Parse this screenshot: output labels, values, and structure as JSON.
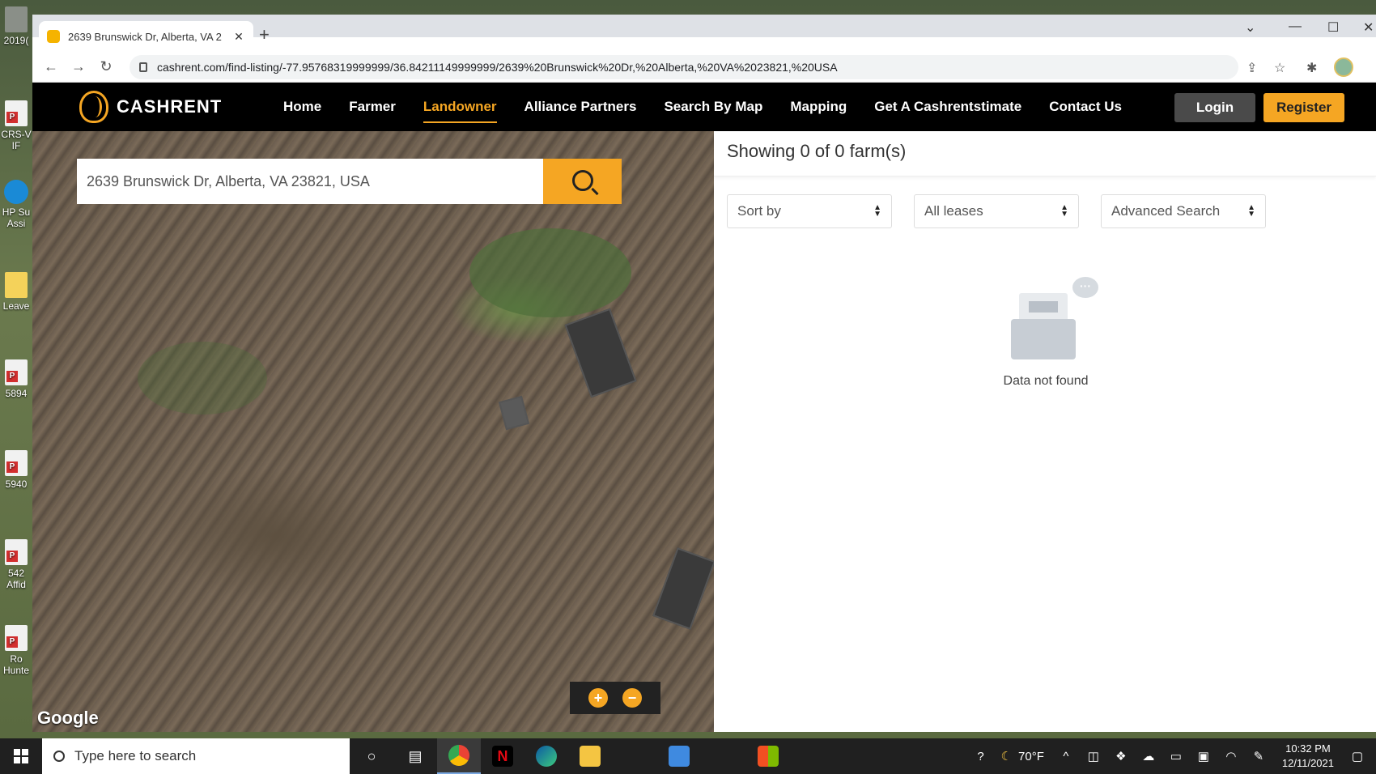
{
  "desktop": {
    "icons": [
      {
        "label": "2019(",
        "type": "photo"
      },
      {
        "label": "CRS-V IF",
        "type": "pdf"
      },
      {
        "label": "HP Su Assi",
        "type": "hp"
      },
      {
        "label": "Leave",
        "type": "folder"
      },
      {
        "label": "5894",
        "type": "pdf"
      },
      {
        "label": "5940",
        "type": "pdf"
      },
      {
        "label": "542 Affid",
        "type": "pdf"
      },
      {
        "label": "Ro Hunte",
        "type": "pdf"
      }
    ]
  },
  "browser": {
    "tab_title": "2639 Brunswick Dr, Alberta, VA 2",
    "url": "cashrent.com/find-listing/-77.95768319999999/36.84211149999999/2639%20Brunswick%20Dr,%20Alberta,%20VA%2023821,%20USA"
  },
  "site": {
    "logo_text": "CASHRENT",
    "nav": [
      {
        "label": "Home",
        "active": false
      },
      {
        "label": "Farmer",
        "active": false
      },
      {
        "label": "Landowner",
        "active": true
      },
      {
        "label": "Alliance Partners",
        "active": false
      },
      {
        "label": "Search By Map",
        "active": false
      },
      {
        "label": "Mapping",
        "active": false
      },
      {
        "label": "Get A Cashrentstimate",
        "active": false
      },
      {
        "label": "Contact Us",
        "active": false
      }
    ],
    "login_label": "Login",
    "register_label": "Register",
    "accent_color": "#f5a623"
  },
  "map": {
    "search_value": "2639 Brunswick Dr, Alberta, VA 23821, USA",
    "zoom_in": "+",
    "zoom_out": "−",
    "attribution": "Google"
  },
  "results": {
    "heading": "Showing 0 of 0 farm(s)",
    "sort_label": "Sort by",
    "lease_label": "All leases",
    "advanced_label": "Advanced Search",
    "empty_text": "Data not found",
    "bubble": "···"
  },
  "taskbar": {
    "search_placeholder": "Type here to search",
    "temperature": "70°F",
    "time": "10:32 PM",
    "date": "12/11/2021"
  }
}
